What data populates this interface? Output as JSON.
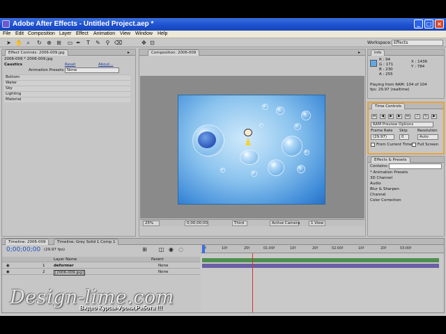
{
  "app": {
    "title": "Adobe After Effects - Untitled Project.aep *",
    "controls": {
      "minimize": "_",
      "maximize": "□",
      "close": "×"
    }
  },
  "menu": [
    "File",
    "Edit",
    "Composition",
    "Layer",
    "Effect",
    "Animation",
    "View",
    "Window",
    "Help"
  ],
  "toolbar": {
    "workspace_label": "Workspace:",
    "workspace_value": "Effects"
  },
  "effect_controls": {
    "tab": "Effect Controls: 2006-009.jpg",
    "breadcrumb": "2006-009 * 2006-009.jpg",
    "effect_name": "Caustics",
    "reset": "Reset",
    "about": "About...",
    "preset_label": "Animation Presets:",
    "preset_value": "None",
    "properties": [
      "Bottom",
      "Water",
      "Sky",
      "Lighting",
      "Material"
    ]
  },
  "composition": {
    "tab": "Composition: 2006-009",
    "zoom": "25%",
    "timecode": "0;00;00;00",
    "resolution": "Third",
    "camera": "Active Camera",
    "view": "1 View"
  },
  "info": {
    "tab": "Info",
    "r": "R : 94",
    "g": "G : 171",
    "b": "B : 230",
    "a": "A : 255",
    "x": "X : 1436",
    "y": "Y : 784",
    "playing": "Playing from RAM: 104 of 104",
    "fps": "fps: 29.97 (realtime)"
  },
  "time_controls": {
    "tab": "Time Controls",
    "options": "RAM Preview Options",
    "frame_rate_label": "Frame Rate",
    "frame_rate": "(29.97)",
    "skip_label": "Skip",
    "skip": "0",
    "resolution_label": "Resolution",
    "resolution": "Auto",
    "from_current": "From Current Time",
    "full_screen": "Full Screen"
  },
  "effects_presets": {
    "tab": "Effects & Presets",
    "contains_label": "Contains:",
    "items": [
      "* Animation Presets",
      "3D Channel",
      "Audio",
      "Blur & Sharpen",
      "Channel",
      "Color Correction"
    ]
  },
  "timeline": {
    "tabs": [
      "Timeline: 2006-009",
      "Timeline: Grey Solid 1 Comp 1"
    ],
    "timecode": "0;00;00;00",
    "fps": "(29.97 fps)",
    "col_layer_name": "Layer Name",
    "col_parent": "Parent",
    "layers": [
      {
        "index": "1",
        "name": "deformer",
        "parent": "None"
      },
      {
        "index": "2",
        "name": "[2006-009.jpg]",
        "parent": "None"
      }
    ],
    "ruler": [
      "0f",
      "10f",
      "20f",
      "01:00f",
      "10f",
      "20f",
      "02:00f",
      "10f",
      "20f",
      "03:00f"
    ],
    "colors": {
      "layer1": "#4f8f4f",
      "layer2": "#6b5fa5",
      "playhead": "#e03030"
    }
  },
  "watermark": {
    "site": "Design-lime.com",
    "tagline": "Видео Курсы-Уроки,Работа !!!"
  }
}
